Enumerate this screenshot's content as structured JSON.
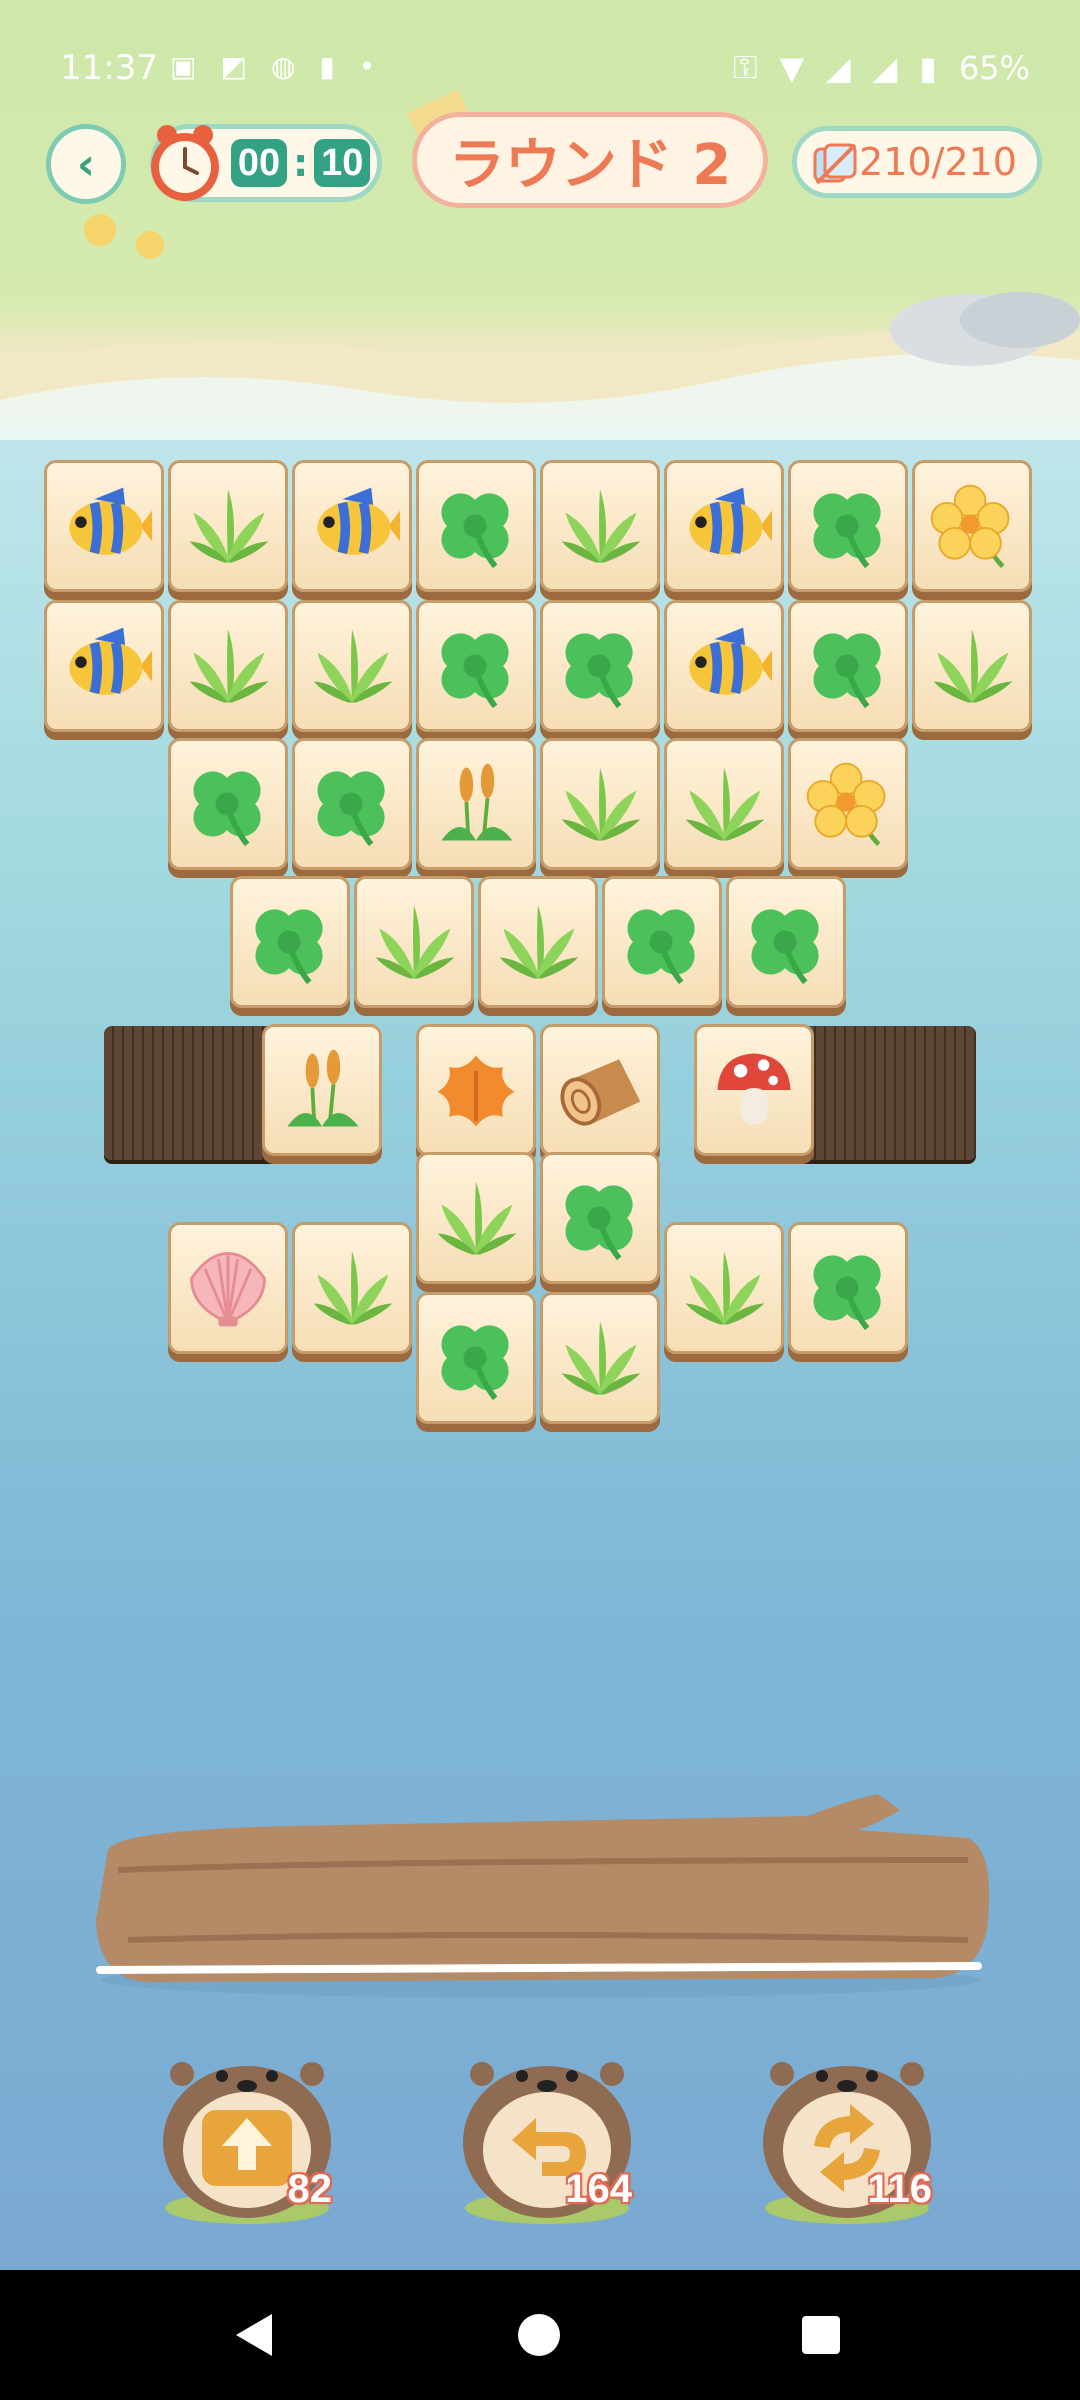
{
  "status_bar": {
    "time": "11:37",
    "battery": "65%",
    "left_icons": [
      "sim-icon",
      "screenshot-icon",
      "line-app-icon",
      "trash-icon",
      "dot-icon"
    ],
    "right_icons": [
      "vpn-key-icon",
      "wifi-icon",
      "signal-icon",
      "signal-icon",
      "battery-icon"
    ]
  },
  "header": {
    "timer_min": "00",
    "timer_sec": "10",
    "round_label": "ラウンド 2",
    "tile_counter": "210/210"
  },
  "board": {
    "rows": [
      [
        "fish",
        "leaf",
        "fish",
        "clover",
        "leaf",
        "fish",
        "clover",
        "flower"
      ],
      [
        "fish",
        "leaf",
        "leaf",
        "clover",
        "clover",
        "fish",
        "clover",
        "leaf"
      ],
      [
        "clover",
        "clover",
        "cattail",
        "leaf",
        "leaf",
        "flower"
      ],
      [
        "clover",
        "leaf",
        "leaf",
        "clover",
        "clover"
      ],
      [
        "cattail",
        "autumn-leaf",
        "log",
        "mushroom"
      ],
      [
        "leaf",
        "clover"
      ],
      [
        "shell",
        "leaf",
        "leaf",
        "clover"
      ],
      [
        "clover",
        "leaf"
      ]
    ]
  },
  "powerups": [
    {
      "name": "shuffle-up",
      "count": "82"
    },
    {
      "name": "undo",
      "count": "164"
    },
    {
      "name": "shuffle",
      "count": "116"
    }
  ],
  "colors": {
    "accent_teal": "#33a184",
    "accent_orange": "#ee7a55",
    "tile_face": "#fff3dc",
    "tile_edge": "#9c6a3e"
  }
}
